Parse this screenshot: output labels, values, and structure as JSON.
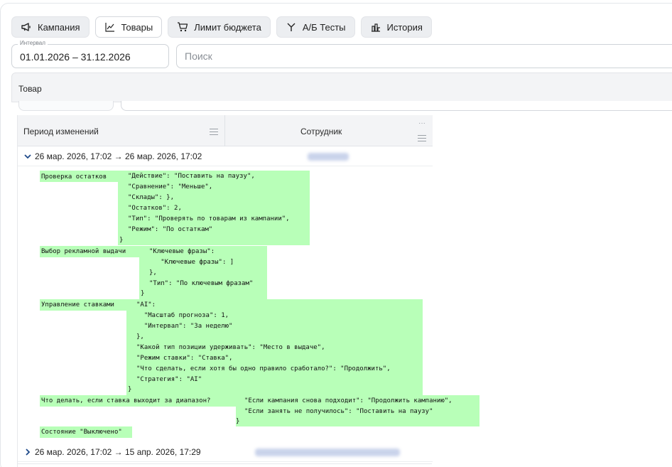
{
  "tabs": [
    {
      "label": "Кампания",
      "icon": "megaphone-icon"
    },
    {
      "label": "Товары",
      "icon": "line-chart-icon"
    },
    {
      "label": "Лимит бюджета",
      "icon": "cart-icon"
    },
    {
      "label": "А/Б Тесты",
      "icon": "split-icon"
    },
    {
      "label": "История",
      "icon": "history-icon"
    }
  ],
  "interval": {
    "label": "Интервал",
    "value": "01.01.2026 – 31.12.2026"
  },
  "search": {
    "placeholder": "Поиск"
  },
  "section": {
    "title": "Товар"
  },
  "grid": {
    "columns": [
      "Период изменений",
      "Сотрудник"
    ],
    "dots": "···",
    "rows": [
      {
        "period": "26 мар. 2026, 17:02 → 26 мар. 2026, 17:02",
        "expanded": true
      },
      {
        "period": "26 мар. 2026, 17:02 → 15 апр. 2026, 17:29",
        "expanded": false
      }
    ]
  },
  "changes": {
    "stock": {
      "label": "Проверка остатков",
      "lines": [
        "\"Действие\": \"Поставить на паузу\",",
        "\"Сравнение\": \"Меньше\",",
        "\"Склады\": },",
        "\"Остатков\": 2,",
        "\"Тип\": \"Проверять по товарам из кампании\",",
        "\"Режим\": \"По остаткам\""
      ],
      "close": "}"
    },
    "ad": {
      "label": "Выбор рекламной выдачи",
      "lines": [
        "\"Ключевые фразы\":",
        "   \"Ключевые фразы\": ]",
        "},",
        "\"Тип\": \"По ключевым фразам\""
      ],
      "close": "}"
    },
    "bids": {
      "label": "Управление ставками",
      "lines": [
        "\"AI\":",
        "  \"Масштаб прогноза\": 1,",
        "  \"Интервал\": \"За неделю\"",
        "},",
        "\"Какой тип позиции удерживать\": \"Место в выдаче\",",
        "\"Режим ставки\": \"Ставка\",",
        "\"Что сделать, если хотя бы одно правило сработало?\": \"Продолжить\",",
        "\"Стратегия\": \"AI\""
      ],
      "close": "}"
    },
    "range": {
      "label": "Что делать, если ставка выходит за диапазон?",
      "lines": [
        "\"Если кампания снова подходит\": \"Продолжить кампанию\",",
        "\"Если занять не получилось\": \"Поставить на паузу\""
      ],
      "close": "}"
    },
    "state": {
      "label": "Состояние \"Выключено\""
    }
  }
}
